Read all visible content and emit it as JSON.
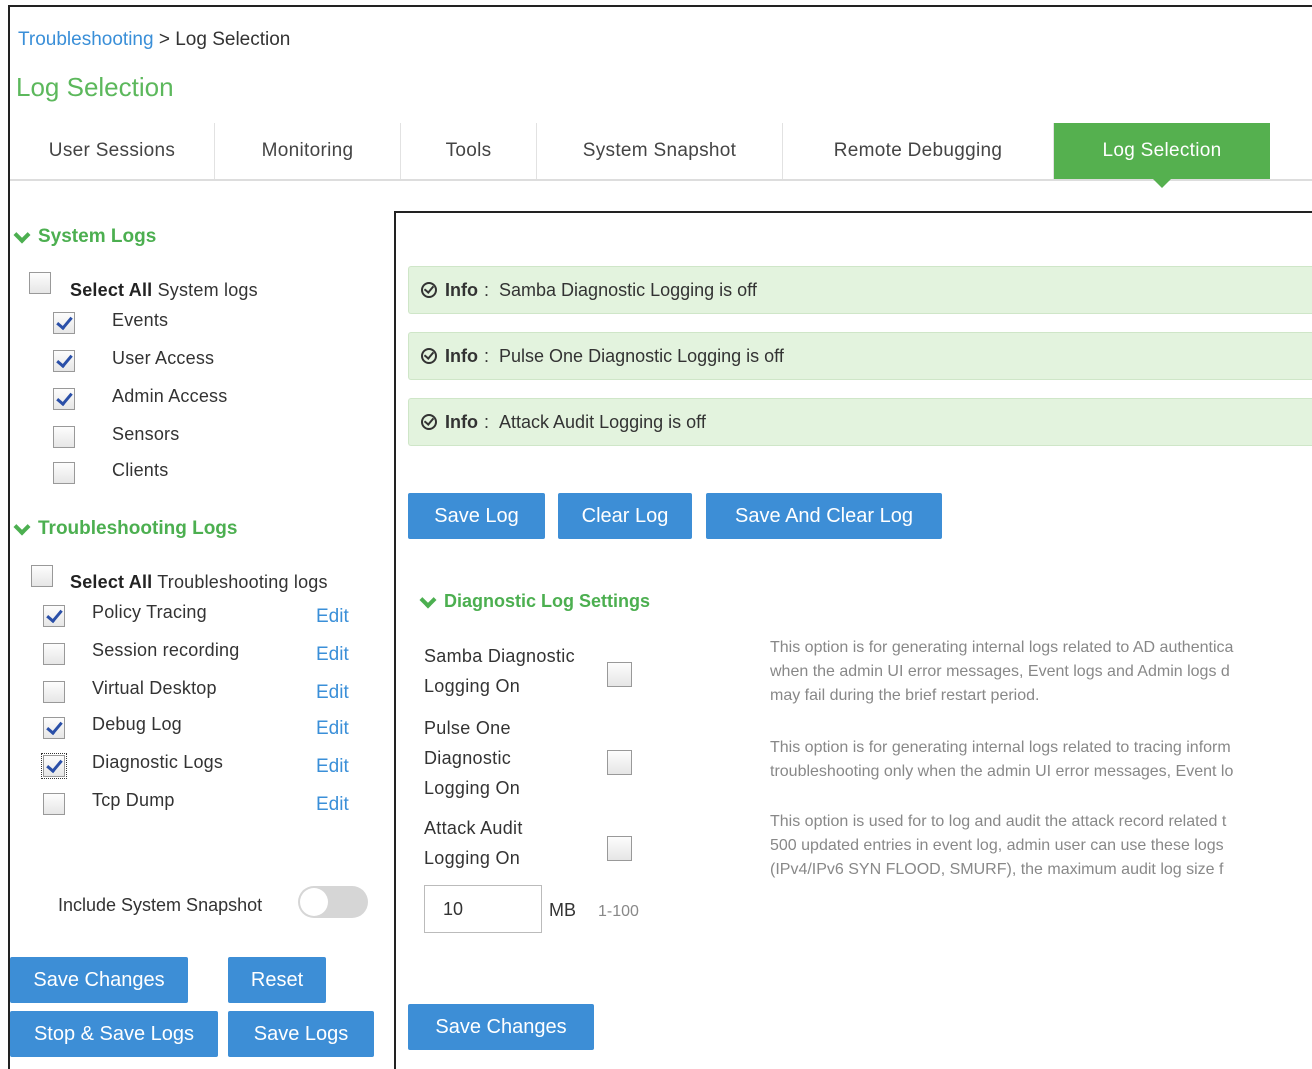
{
  "breadcrumb": {
    "parent": "Troubleshooting",
    "separator": " > ",
    "current": "Log Selection"
  },
  "page_title": "Log Selection",
  "tabs": [
    {
      "label": "User Sessions",
      "active": false
    },
    {
      "label": "Monitoring",
      "active": false
    },
    {
      "label": "Tools",
      "active": false
    },
    {
      "label": "System Snapshot",
      "active": false
    },
    {
      "label": "Remote Debugging",
      "active": false
    },
    {
      "label": "Log Selection",
      "active": true
    }
  ],
  "system_logs": {
    "heading": "System Logs",
    "select_all_bold": "Select All",
    "select_all_rest": " System logs",
    "select_all_checked": false,
    "items": [
      {
        "label": "Events",
        "checked": true
      },
      {
        "label": "User Access",
        "checked": true
      },
      {
        "label": "Admin Access",
        "checked": true
      },
      {
        "label": "Sensors",
        "checked": false
      },
      {
        "label": "Clients",
        "checked": false
      }
    ]
  },
  "troubleshooting_logs": {
    "heading": "Troubleshooting Logs",
    "select_all_bold": "Select All",
    "select_all_rest": " Troubleshooting logs",
    "select_all_checked": false,
    "edit_label": "Edit",
    "items": [
      {
        "label": "Policy Tracing",
        "checked": true
      },
      {
        "label": "Session recording",
        "checked": false
      },
      {
        "label": "Virtual Desktop",
        "checked": false
      },
      {
        "label": "Debug Log",
        "checked": true
      },
      {
        "label": "Diagnostic Logs",
        "checked": true
      },
      {
        "label": "Tcp Dump",
        "checked": false
      }
    ]
  },
  "include_snapshot": {
    "label": "Include System Snapshot",
    "on": false
  },
  "left_buttons": {
    "save_changes": "Save Changes",
    "reset": "Reset",
    "stop_save_logs": "Stop & Save Logs",
    "save_logs": "Save Logs"
  },
  "info_messages": [
    {
      "tag": "Info",
      "sep": ":",
      "text": "Samba Diagnostic Logging is off"
    },
    {
      "tag": "Info",
      "sep": ":",
      "text": "Pulse One Diagnostic Logging is off"
    },
    {
      "tag": "Info",
      "sep": ":",
      "text": "Attack Audit Logging is off"
    }
  ],
  "log_buttons": {
    "save_log": "Save Log",
    "clear_log": "Clear Log",
    "save_and_clear": "Save And Clear Log"
  },
  "diagnostic": {
    "heading": "Diagnostic Log Settings",
    "options": [
      {
        "label_lines": [
          "Samba Diagnostic",
          "Logging On"
        ],
        "checked": false,
        "desc_lines": [
          "This option is for generating internal logs related to AD authentica",
          "when the admin UI error messages, Event logs and Admin logs d",
          "may fail during the brief restart period."
        ]
      },
      {
        "label_lines": [
          "Pulse One",
          "Diagnostic",
          "Logging On"
        ],
        "checked": false,
        "desc_lines": [
          "This option is for generating internal logs related to tracing inform",
          "troubleshooting only when the admin UI error messages, Event lo"
        ]
      },
      {
        "label_lines": [
          "Attack Audit",
          "Logging On"
        ],
        "checked": false,
        "desc_lines": [
          "This option is used for to log and audit the attack record related t",
          "500 updated entries in event log, admin user can use these logs",
          "(IPv4/IPv6 SYN FLOOD, SMURF), the maximum audit log size f"
        ]
      }
    ],
    "size_value": "10",
    "size_unit": "MB",
    "size_range": "1-100"
  },
  "panel_save_changes": "Save Changes"
}
